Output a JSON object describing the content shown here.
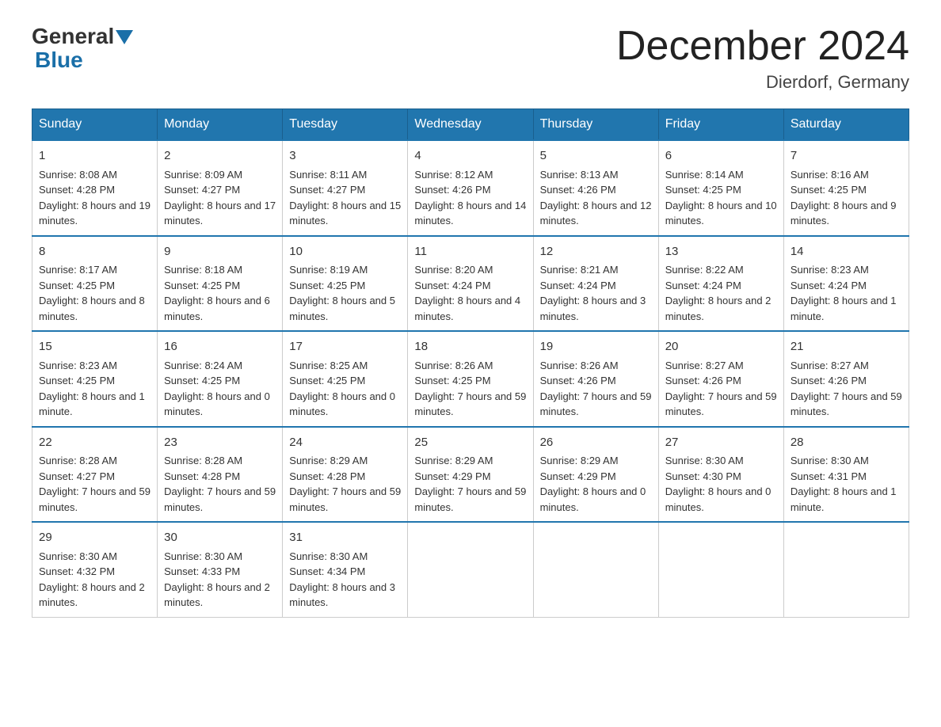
{
  "header": {
    "logo_general": "General",
    "logo_blue": "Blue",
    "month_title": "December 2024",
    "location": "Dierdorf, Germany"
  },
  "days_of_week": [
    "Sunday",
    "Monday",
    "Tuesday",
    "Wednesday",
    "Thursday",
    "Friday",
    "Saturday"
  ],
  "weeks": [
    [
      {
        "day": "1",
        "sunrise": "Sunrise: 8:08 AM",
        "sunset": "Sunset: 4:28 PM",
        "daylight": "Daylight: 8 hours and 19 minutes."
      },
      {
        "day": "2",
        "sunrise": "Sunrise: 8:09 AM",
        "sunset": "Sunset: 4:27 PM",
        "daylight": "Daylight: 8 hours and 17 minutes."
      },
      {
        "day": "3",
        "sunrise": "Sunrise: 8:11 AM",
        "sunset": "Sunset: 4:27 PM",
        "daylight": "Daylight: 8 hours and 15 minutes."
      },
      {
        "day": "4",
        "sunrise": "Sunrise: 8:12 AM",
        "sunset": "Sunset: 4:26 PM",
        "daylight": "Daylight: 8 hours and 14 minutes."
      },
      {
        "day": "5",
        "sunrise": "Sunrise: 8:13 AM",
        "sunset": "Sunset: 4:26 PM",
        "daylight": "Daylight: 8 hours and 12 minutes."
      },
      {
        "day": "6",
        "sunrise": "Sunrise: 8:14 AM",
        "sunset": "Sunset: 4:25 PM",
        "daylight": "Daylight: 8 hours and 10 minutes."
      },
      {
        "day": "7",
        "sunrise": "Sunrise: 8:16 AM",
        "sunset": "Sunset: 4:25 PM",
        "daylight": "Daylight: 8 hours and 9 minutes."
      }
    ],
    [
      {
        "day": "8",
        "sunrise": "Sunrise: 8:17 AM",
        "sunset": "Sunset: 4:25 PM",
        "daylight": "Daylight: 8 hours and 8 minutes."
      },
      {
        "day": "9",
        "sunrise": "Sunrise: 8:18 AM",
        "sunset": "Sunset: 4:25 PM",
        "daylight": "Daylight: 8 hours and 6 minutes."
      },
      {
        "day": "10",
        "sunrise": "Sunrise: 8:19 AM",
        "sunset": "Sunset: 4:25 PM",
        "daylight": "Daylight: 8 hours and 5 minutes."
      },
      {
        "day": "11",
        "sunrise": "Sunrise: 8:20 AM",
        "sunset": "Sunset: 4:24 PM",
        "daylight": "Daylight: 8 hours and 4 minutes."
      },
      {
        "day": "12",
        "sunrise": "Sunrise: 8:21 AM",
        "sunset": "Sunset: 4:24 PM",
        "daylight": "Daylight: 8 hours and 3 minutes."
      },
      {
        "day": "13",
        "sunrise": "Sunrise: 8:22 AM",
        "sunset": "Sunset: 4:24 PM",
        "daylight": "Daylight: 8 hours and 2 minutes."
      },
      {
        "day": "14",
        "sunrise": "Sunrise: 8:23 AM",
        "sunset": "Sunset: 4:24 PM",
        "daylight": "Daylight: 8 hours and 1 minute."
      }
    ],
    [
      {
        "day": "15",
        "sunrise": "Sunrise: 8:23 AM",
        "sunset": "Sunset: 4:25 PM",
        "daylight": "Daylight: 8 hours and 1 minute."
      },
      {
        "day": "16",
        "sunrise": "Sunrise: 8:24 AM",
        "sunset": "Sunset: 4:25 PM",
        "daylight": "Daylight: 8 hours and 0 minutes."
      },
      {
        "day": "17",
        "sunrise": "Sunrise: 8:25 AM",
        "sunset": "Sunset: 4:25 PM",
        "daylight": "Daylight: 8 hours and 0 minutes."
      },
      {
        "day": "18",
        "sunrise": "Sunrise: 8:26 AM",
        "sunset": "Sunset: 4:25 PM",
        "daylight": "Daylight: 7 hours and 59 minutes."
      },
      {
        "day": "19",
        "sunrise": "Sunrise: 8:26 AM",
        "sunset": "Sunset: 4:26 PM",
        "daylight": "Daylight: 7 hours and 59 minutes."
      },
      {
        "day": "20",
        "sunrise": "Sunrise: 8:27 AM",
        "sunset": "Sunset: 4:26 PM",
        "daylight": "Daylight: 7 hours and 59 minutes."
      },
      {
        "day": "21",
        "sunrise": "Sunrise: 8:27 AM",
        "sunset": "Sunset: 4:26 PM",
        "daylight": "Daylight: 7 hours and 59 minutes."
      }
    ],
    [
      {
        "day": "22",
        "sunrise": "Sunrise: 8:28 AM",
        "sunset": "Sunset: 4:27 PM",
        "daylight": "Daylight: 7 hours and 59 minutes."
      },
      {
        "day": "23",
        "sunrise": "Sunrise: 8:28 AM",
        "sunset": "Sunset: 4:28 PM",
        "daylight": "Daylight: 7 hours and 59 minutes."
      },
      {
        "day": "24",
        "sunrise": "Sunrise: 8:29 AM",
        "sunset": "Sunset: 4:28 PM",
        "daylight": "Daylight: 7 hours and 59 minutes."
      },
      {
        "day": "25",
        "sunrise": "Sunrise: 8:29 AM",
        "sunset": "Sunset: 4:29 PM",
        "daylight": "Daylight: 7 hours and 59 minutes."
      },
      {
        "day": "26",
        "sunrise": "Sunrise: 8:29 AM",
        "sunset": "Sunset: 4:29 PM",
        "daylight": "Daylight: 8 hours and 0 minutes."
      },
      {
        "day": "27",
        "sunrise": "Sunrise: 8:30 AM",
        "sunset": "Sunset: 4:30 PM",
        "daylight": "Daylight: 8 hours and 0 minutes."
      },
      {
        "day": "28",
        "sunrise": "Sunrise: 8:30 AM",
        "sunset": "Sunset: 4:31 PM",
        "daylight": "Daylight: 8 hours and 1 minute."
      }
    ],
    [
      {
        "day": "29",
        "sunrise": "Sunrise: 8:30 AM",
        "sunset": "Sunset: 4:32 PM",
        "daylight": "Daylight: 8 hours and 2 minutes."
      },
      {
        "day": "30",
        "sunrise": "Sunrise: 8:30 AM",
        "sunset": "Sunset: 4:33 PM",
        "daylight": "Daylight: 8 hours and 2 minutes."
      },
      {
        "day": "31",
        "sunrise": "Sunrise: 8:30 AM",
        "sunset": "Sunset: 4:34 PM",
        "daylight": "Daylight: 8 hours and 3 minutes."
      },
      null,
      null,
      null,
      null
    ]
  ]
}
